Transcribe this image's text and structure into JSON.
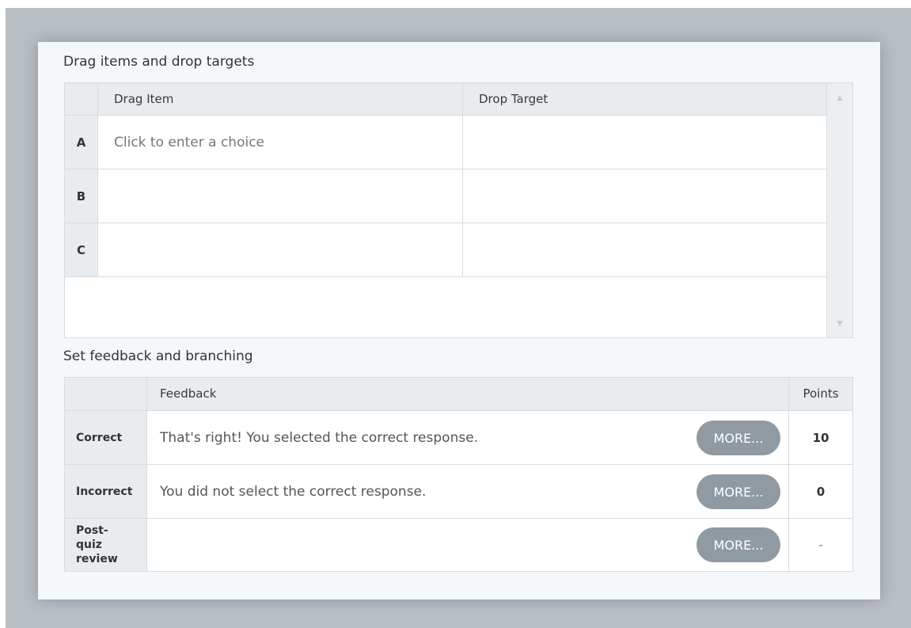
{
  "sections": {
    "drag_title": "Drag items and drop targets",
    "feedback_title": "Set feedback and branching"
  },
  "drag_table": {
    "headers": {
      "drag_item": "Drag Item",
      "drop_target": "Drop Target"
    },
    "rows": [
      {
        "letter": "A",
        "drag_item": "Click to enter a choice",
        "drop_target": ""
      },
      {
        "letter": "B",
        "drag_item": "",
        "drop_target": ""
      },
      {
        "letter": "C",
        "drag_item": "",
        "drop_target": ""
      }
    ],
    "scroll_up_icon": "▲",
    "scroll_down_icon": "▼"
  },
  "feedback_table": {
    "headers": {
      "feedback": "Feedback",
      "points": "Points"
    },
    "rows": [
      {
        "label": "Correct",
        "feedback": "That's right!  You selected the correct response.",
        "more": "MORE...",
        "points": "10"
      },
      {
        "label": "Incorrect",
        "feedback": "You did not select the correct response.",
        "more": "MORE...",
        "points": "0"
      },
      {
        "label": "Post-quiz review",
        "feedback": "",
        "more": "MORE...",
        "points": "-"
      }
    ]
  },
  "colors": {
    "backdrop": "#b7bec4",
    "panel": "#f5f8fa",
    "header_bg": "#e8ecef",
    "more_button": "#8f9aa3"
  }
}
